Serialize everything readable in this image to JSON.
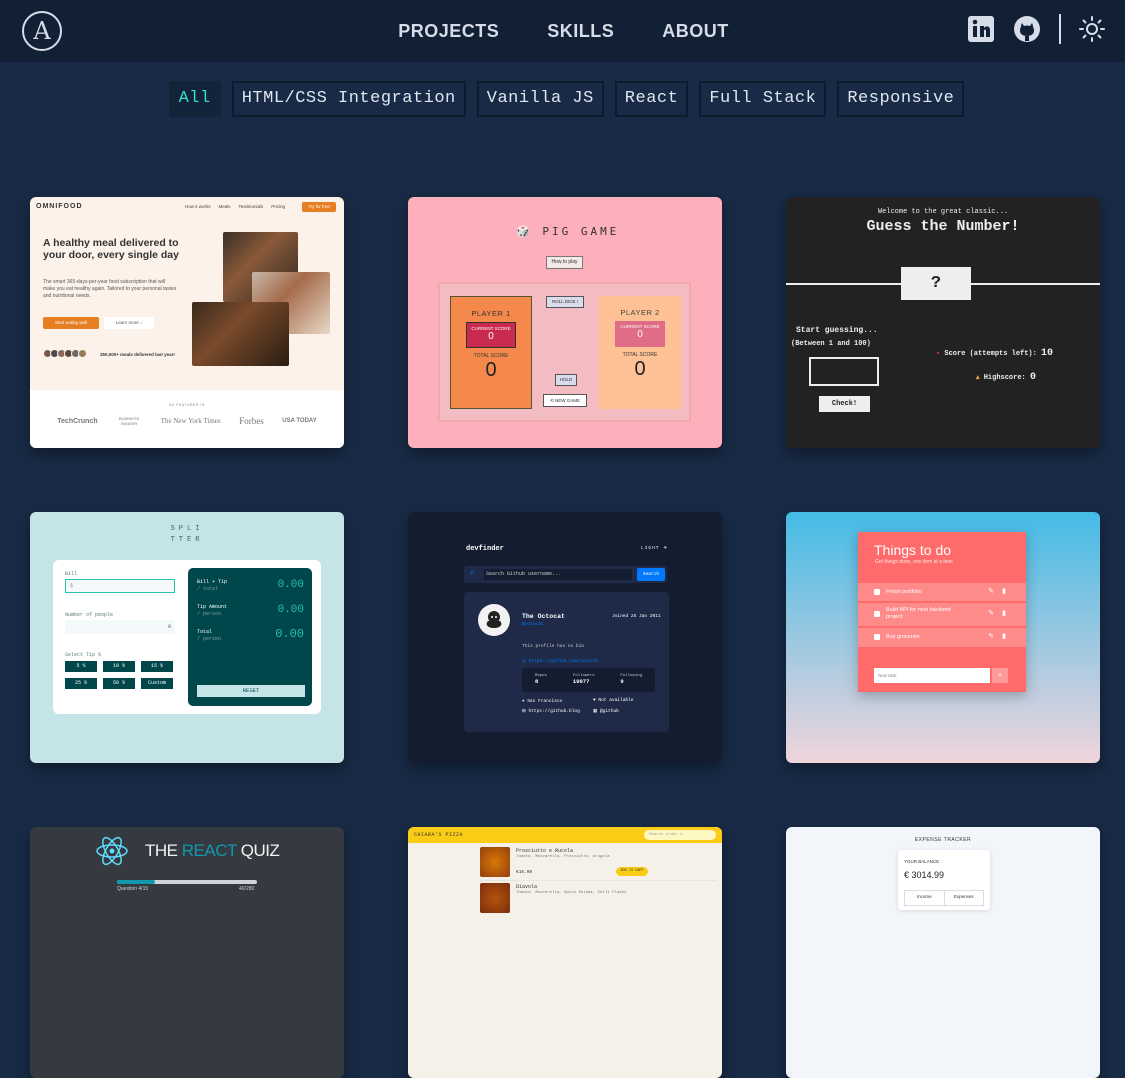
{
  "nav": {
    "logo": "A",
    "links": [
      "PROJECTS",
      "SKILLS",
      "ABOUT"
    ],
    "icons": [
      "linkedin-icon",
      "github-icon",
      "sun-icon"
    ]
  },
  "filters": [
    "All",
    "HTML/CSS Integration",
    "Vanilla JS",
    "React",
    "Full Stack",
    "Responsive"
  ],
  "omnifood": {
    "brand": "OMNIFOOD",
    "nav": [
      "How it works",
      "Meals",
      "Testimonials",
      "Pricing"
    ],
    "cta": "Try for free",
    "headline": "A healthy meal delivered to your door, every single day",
    "text": "The smart 365-days-per-year food subscription that will make you eat healthy again. Tailored to your personal tastes and nutritional needs.",
    "btn1": "Start eating well",
    "btn2": "Learn more ↓",
    "delivered": "250,000+ meals delivered last year!",
    "featured": "AS FEATURED IN",
    "press": [
      "TechCrunch",
      "BUSINESS INSIDER",
      "The New York Times",
      "Forbes",
      "USA TODAY"
    ]
  },
  "pig": {
    "title": "PIG GAME",
    "how": "How to play",
    "p1": "PLAYER 1",
    "p2": "PLAYER 2",
    "current": "CURRENT SCORE",
    "total": "TOTAL SCORE",
    "c1": "0",
    "t1": "0",
    "c2": "0",
    "t2": "0",
    "roll": "ROLL DICE !",
    "hold": "HOLD",
    "newgame": "NEW GAME"
  },
  "guess": {
    "welcome": "Welcome to the great classic...",
    "title": "Guess the Number!",
    "q": "?",
    "start": "Start guessing...",
    "between": "(Between 1 and 100)",
    "score_label": "Score (attempts left):",
    "score": "10",
    "high_label": "Highscore:",
    "high": "0",
    "check": "Check!"
  },
  "splitter": {
    "logo1": "SPLI",
    "logo2": "TTER",
    "bill": "Bill",
    "people": "Number of people",
    "people_val": "0",
    "tip": "Select Tip %",
    "tips": [
      "5 %",
      "10 %",
      "15 %",
      "25 %",
      "50 %",
      "Custom"
    ],
    "r1a": "Bill + Tip",
    "r1b": "/ total",
    "v1": "0.00",
    "r2a": "Tip Amount",
    "r2b": "/ person",
    "v2": "0.00",
    "r3a": "Total",
    "r3b": "/ person",
    "v3": "0.00",
    "reset": "RESET"
  },
  "dev": {
    "logo": "devfinder",
    "mode": "LIGHT",
    "search": "Search Github username...",
    "btn": "Search",
    "name": "The Octocat",
    "handle": "@octocat",
    "joined": "Joined 25 Jan 2011",
    "bio": "This profile has no bio",
    "link": "https://github.com/octocat",
    "stats": [
      {
        "l": "Repos",
        "v": "8"
      },
      {
        "l": "Followers",
        "v": "10077"
      },
      {
        "l": "Following",
        "v": "9"
      }
    ],
    "loc": "San Francisco",
    "twitter": "Not available",
    "blog": "https://github.blog",
    "company": "@github"
  },
  "todo": {
    "title": "Things to do",
    "sub": "Get things done, one item at a time",
    "items": [
      "Finish portfolio",
      "Build API for next backend project",
      "Buy groceries"
    ],
    "placeholder": "New task",
    "add": "+"
  },
  "quiz": {
    "title_a": "THE ",
    "title_b": "REACT",
    "title_c": " QUIZ",
    "q": "Question 4/15",
    "pts": "40/280",
    "progress": 0.27
  },
  "pizza": {
    "brand": "CHIARA'S PIZZA",
    "search": "Search order #",
    "items": [
      {
        "n": "Prosciutto e Rucola",
        "i": "Tomato, Mozzarella, Prosciutto, Arugula",
        "p": "€16.00"
      },
      {
        "n": "Diavola",
        "i": "Tomato, Mozzarella, Spicy Salami, Chili Flakes",
        "p": ""
      }
    ],
    "add": "ADD TO CART"
  },
  "expense": {
    "title": "EXPENSE TRACKER",
    "bal_label": "YOUR BALANCE",
    "bal": "€ 3014.99",
    "inc": "Income",
    "exp": "Expenses"
  },
  "colors": {
    "accent": "#33e0c4",
    "bg": "#182a45",
    "nav": "#122036"
  }
}
